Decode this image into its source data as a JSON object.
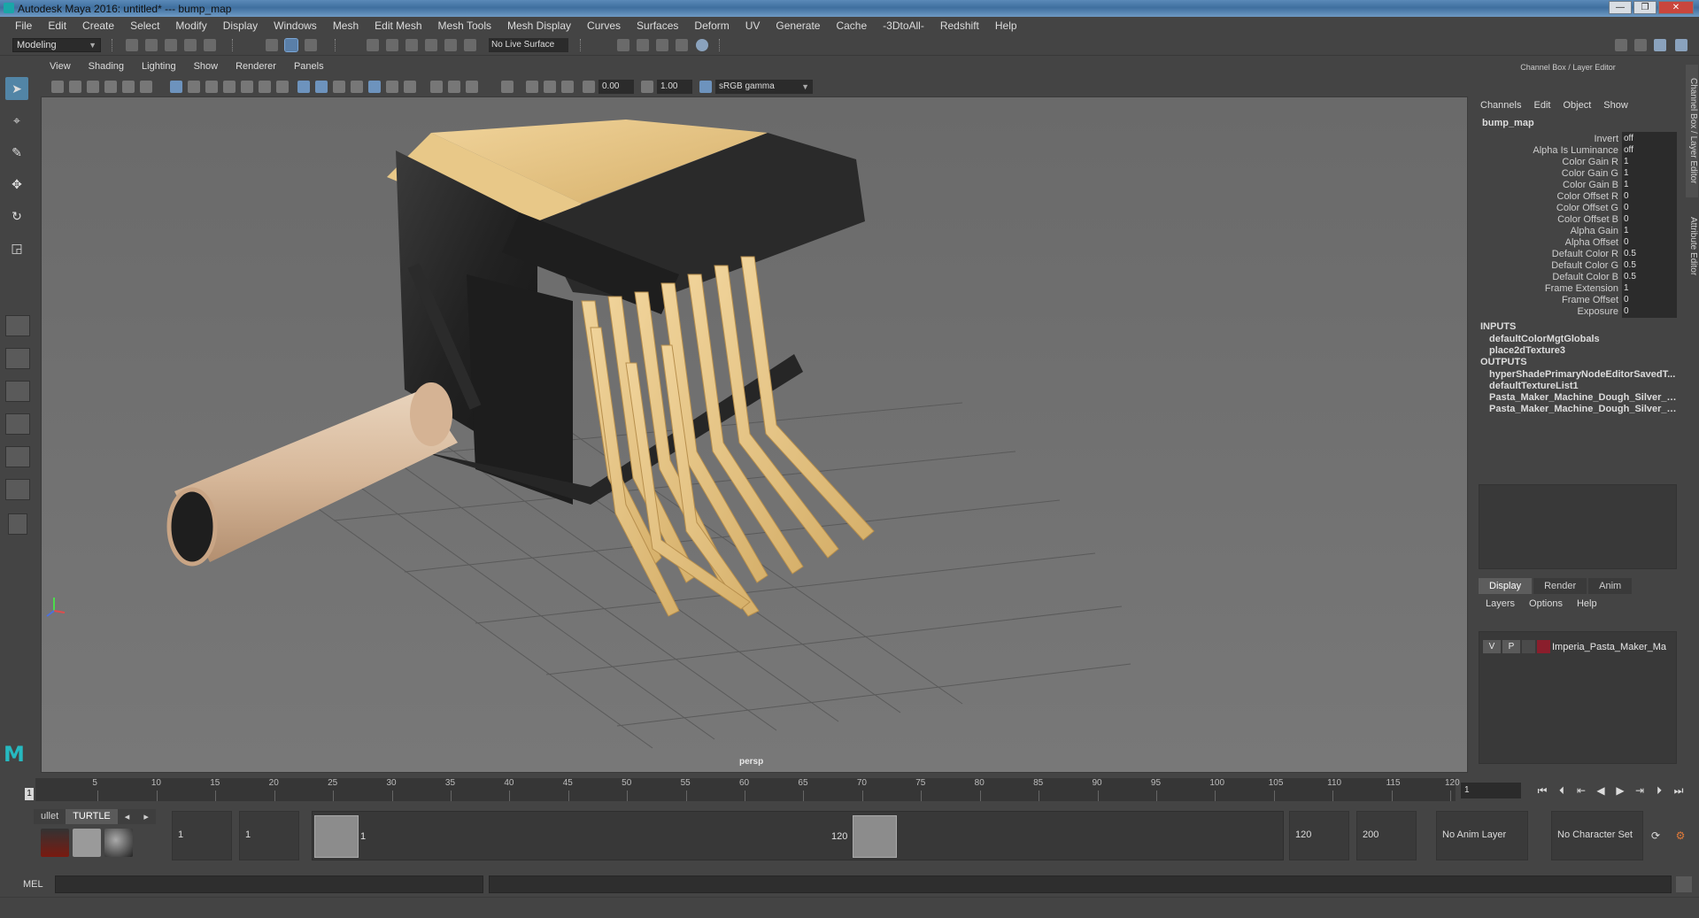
{
  "window": {
    "title": "Autodesk Maya 2016: untitled*   ---   bump_map",
    "controls": [
      "—",
      "❐",
      "✕"
    ]
  },
  "menubar": [
    "File",
    "Edit",
    "Create",
    "Select",
    "Modify",
    "Display",
    "Windows",
    "Mesh",
    "Edit Mesh",
    "Mesh Tools",
    "Mesh Display",
    "Curves",
    "Surfaces",
    "Deform",
    "UV",
    "Generate",
    "Cache",
    "-3DtoAll-",
    "Redshift",
    "Help"
  ],
  "statusline": {
    "mode": "Modeling",
    "live_surface": "No Live Surface"
  },
  "panel": {
    "menu": [
      "View",
      "Shading",
      "Lighting",
      "Show",
      "Renderer",
      "Panels"
    ],
    "exposure": "0.00",
    "gamma": "1.00",
    "color_space": "sRGB gamma",
    "camera": "persp"
  },
  "channel_box": {
    "title": "Channel Box / Layer Editor",
    "menu": [
      "Channels",
      "Edit",
      "Object",
      "Show"
    ],
    "node": "bump_map",
    "attributes": [
      {
        "label": "Invert",
        "value": "off"
      },
      {
        "label": "Alpha Is Luminance",
        "value": "off"
      },
      {
        "label": "Color Gain R",
        "value": "1"
      },
      {
        "label": "Color Gain G",
        "value": "1"
      },
      {
        "label": "Color Gain B",
        "value": "1"
      },
      {
        "label": "Color Offset R",
        "value": "0"
      },
      {
        "label": "Color Offset G",
        "value": "0"
      },
      {
        "label": "Color Offset B",
        "value": "0"
      },
      {
        "label": "Alpha Gain",
        "value": "1"
      },
      {
        "label": "Alpha Offset",
        "value": "0"
      },
      {
        "label": "Default Color R",
        "value": "0.5"
      },
      {
        "label": "Default Color G",
        "value": "0.5"
      },
      {
        "label": "Default Color B",
        "value": "0.5"
      },
      {
        "label": "Frame Extension",
        "value": "1"
      },
      {
        "label": "Frame Offset",
        "value": "0"
      },
      {
        "label": "Exposure",
        "value": "0"
      }
    ],
    "inputs_label": "INPUTS",
    "inputs": [
      "defaultColorMgtGlobals",
      "place2dTexture3"
    ],
    "outputs_label": "OUTPUTS",
    "outputs": [
      "hyperShadePrimaryNodeEditorSavedT...",
      "defaultTextureList1",
      "Pasta_Maker_Machine_Dough_Silver_S...",
      "Pasta_Maker_Machine_Dough_Silver_SM"
    ]
  },
  "layer_editor": {
    "tabs": [
      "Display",
      "Render",
      "Anim"
    ],
    "menu": [
      "Layers",
      "Options",
      "Help"
    ],
    "layer": {
      "v": "V",
      "p": "P",
      "name": "Imperia_Pasta_Maker_Ma",
      "color": "#8a1e2c"
    }
  },
  "side_tabs": [
    "Channel Box / Layer Editor",
    "Attribute Editor"
  ],
  "timeline": {
    "ticks": [
      "5",
      "10",
      "15",
      "20",
      "25",
      "30",
      "35",
      "40",
      "45",
      "50",
      "55",
      "60",
      "65",
      "70",
      "75",
      "80",
      "85",
      "90",
      "95",
      "100",
      "105",
      "110",
      "115",
      "120"
    ],
    "current_frame": "1",
    "current_field": "1"
  },
  "range": {
    "shelf_tabs": [
      "ullet",
      "TURTLE"
    ],
    "start": "1",
    "playback_start": "1",
    "slider_start": "1",
    "slider_end": "120",
    "playback_end": "120",
    "end": "200",
    "anim_layer": "No Anim Layer",
    "character_set": "No Character Set"
  },
  "cmdline": {
    "label": "MEL"
  }
}
